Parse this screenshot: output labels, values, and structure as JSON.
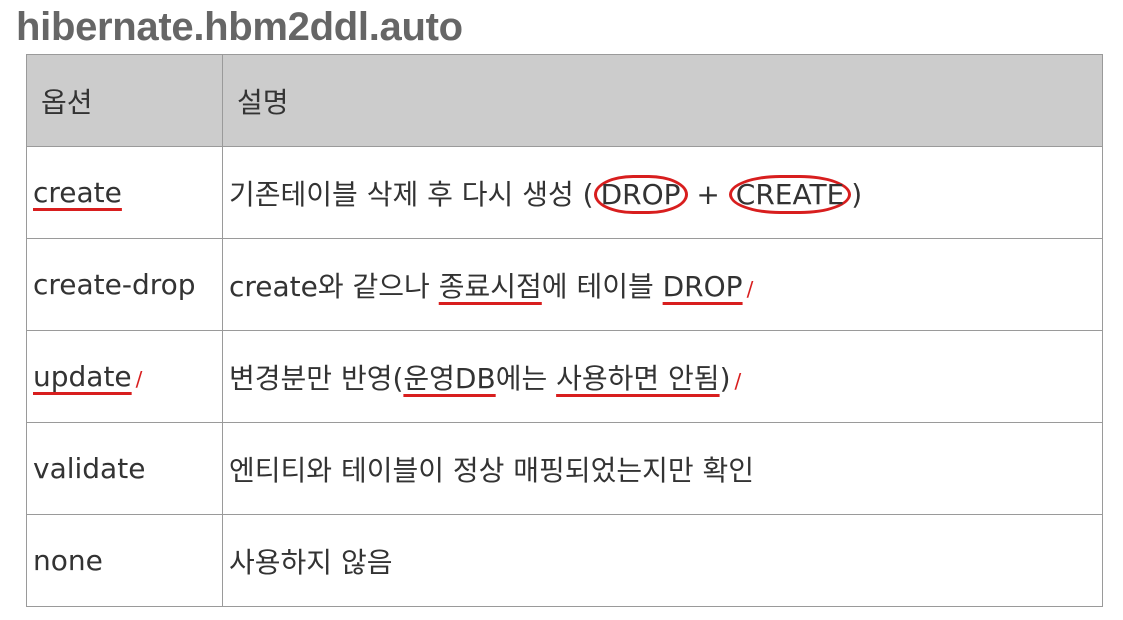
{
  "title": "hibernate.hbm2ddl.auto",
  "table": {
    "headers": [
      "옵션",
      "설명"
    ],
    "rows": [
      {
        "option": "create",
        "desc_parts": [
          "기존테이블 삭제 후 다시 생성 (",
          "DROP",
          " + ",
          "CREATE",
          ")"
        ]
      },
      {
        "option": "create-drop",
        "desc_parts": [
          "create와 같으나 ",
          "종료시점",
          "에 테이블 ",
          "DROP"
        ]
      },
      {
        "option": "update",
        "desc_parts": [
          "변경분만 반영(",
          "운영DB",
          "에는 ",
          "사용하면 안됨",
          ")"
        ]
      },
      {
        "option": "validate",
        "desc_parts": [
          "엔티티와 테이블이 정상 매핑되었는지만 확인"
        ]
      },
      {
        "option": "none",
        "desc_parts": [
          "사용하지 않음"
        ]
      }
    ]
  },
  "annotation": {
    "ink_color": "#d81e1e",
    "tick_mark": "/"
  }
}
